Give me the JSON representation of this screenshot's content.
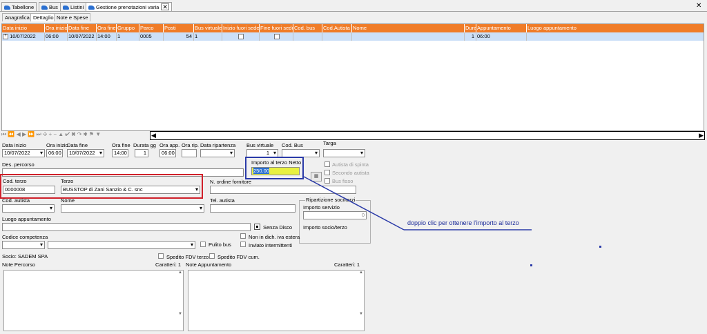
{
  "tabs": [
    "Tabellone",
    "Bus",
    "Listini",
    "Gestione prenotazioni varia"
  ],
  "close_glyph": "✕",
  "subtabs": [
    "Anagrafica",
    "Dettaglio",
    "Note e Spese"
  ],
  "grid": {
    "headers": [
      "Data inizio",
      "Ora inizio",
      "Data fine",
      "Ora fine",
      "Gruppo",
      "Parco",
      "Posti",
      "Bus virtuale",
      "Inizio fuori sede",
      "Fine fuori sede",
      "Cod. bus",
      "Cod.Autista",
      "Nome",
      "Dura",
      "Appuntamento",
      "Luogo appuntamento"
    ],
    "row": {
      "expand": "+",
      "data_inizio": "10/07/2022",
      "ora_inizio": "06:00",
      "data_fine": "10/07/2022",
      "ora_fine": "14:00",
      "gruppo": "1",
      "parco": "0005",
      "posti": "54",
      "bus_virtuale": "1",
      "durata": "1",
      "appuntamento": "06:00"
    }
  },
  "nav_glyphs": "⏮ ⏪ ◀ ▶ ⏩ ⏭ ✣ + − ▲ ✔ ✖ ↷ ✱ ⚑ ▼",
  "scroll": {
    "left": "◀",
    "right": "▶"
  },
  "form": {
    "data_inizio_label": "Data inizio",
    "data_inizio": "10/07/2022",
    "ora_inizio_label": "Ora inizio",
    "ora_inizio": "06:00",
    "data_fine_label": "Data fine",
    "data_fine": "10/07/2022",
    "ora_fine_label": "Ora fine",
    "ora_fine": "14:00",
    "durata_label": "Durata gg",
    "durata": "1",
    "ora_app_label": "Ora app.",
    "ora_app": "06:00",
    "ora_rip_label": "Ora rip.",
    "data_ripartenza_label": "Data ripartenza",
    "bus_virtuale_label": "Bus virtuale",
    "bus_virtuale": "1",
    "cod_bus_label": "Cod. Bus",
    "targa_label": "Targa",
    "des_percorso_label": "Des. percorso",
    "importo_label": "Importo al terzo Netto",
    "importo": "250.00",
    "autista_spinta": "Autista di spinta",
    "secondo_autista": "Secondo autista",
    "bus_fisso": "Bus fisso",
    "cod_terzo_label": "Cod. terzo",
    "cod_terzo": "0000008",
    "terzo_label": "Terzo",
    "terzo": "BUSSTOP di Zani Sanzio & C. snc",
    "n_ordine_label": "N. ordine fornitore",
    "cod_autista_label": "Cod. autista",
    "nome_label": "Nome",
    "tel_autista_label": "Tel. autista",
    "ripartizione_label": "Ripartizione soci/terzi",
    "importo_servizio_label": "Importo servizio",
    "importo_servizio": "0",
    "importo_socio_label": "Importo socio/terzo",
    "luogo_label": "Luogo appuntamento",
    "senza_disco": "Senza Disco",
    "codice_competenza_label": "Codice competenza",
    "non_dich": "Non in dich. iva estera",
    "inviato": "Inviato intermittenti",
    "pulito_bus": "Pulito bus",
    "socio": "Socio: SADEM SPA",
    "spedito_terzo": "Spedito FDV terzo",
    "spedito_cum": "Spedito FDV cum.",
    "note_percorso_label": "Note Percorso",
    "caratteri1": "Caratteri: 1",
    "note_app_label": "Note Appuntamento",
    "caratteri2": "Caratteri: 1"
  },
  "annotation": "doppio clic per ottenere l'importo al terzo",
  "colors": {
    "header": "#f07c28",
    "row_selected": "#cce0f8",
    "highlight_red": "#d0202a",
    "highlight_blue": "#2a3aa8"
  }
}
